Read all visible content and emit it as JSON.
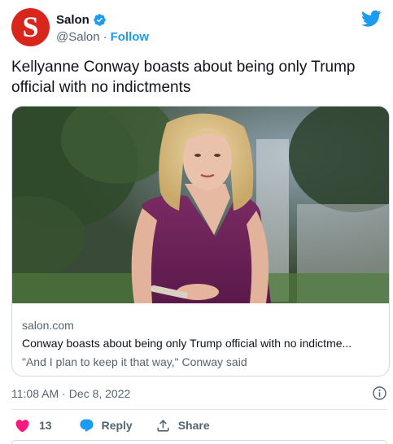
{
  "account": {
    "avatar_letter": "S",
    "name": "Salon",
    "handle": "@Salon",
    "separator": "·",
    "follow_label": "Follow"
  },
  "tweet": {
    "text": "Kellyanne Conway boasts about being only Trump official with no indictments"
  },
  "card": {
    "image_alt": "Kellyanne Conway photo",
    "domain": "salon.com",
    "title": "Conway boasts about being only Trump official with no indictme...",
    "description": "\"And I plan to keep it that way,\" Conway said"
  },
  "meta": {
    "time": "11:08 AM",
    "separator": "·",
    "date": "Dec 8, 2022"
  },
  "actions": {
    "like_count": "13",
    "reply_label": "Reply",
    "share_label": "Share"
  },
  "colors": {
    "brand_red": "#d9261c",
    "twitter_blue": "#1d9bf0",
    "like_pink": "#f91880",
    "text_primary": "#0f1419",
    "text_secondary": "#536471",
    "border": "#cfd9de"
  },
  "icons": [
    "verified-badge-icon",
    "twitter-bird-icon",
    "info-icon",
    "heart-icon",
    "reply-bubble-icon",
    "share-icon"
  ]
}
